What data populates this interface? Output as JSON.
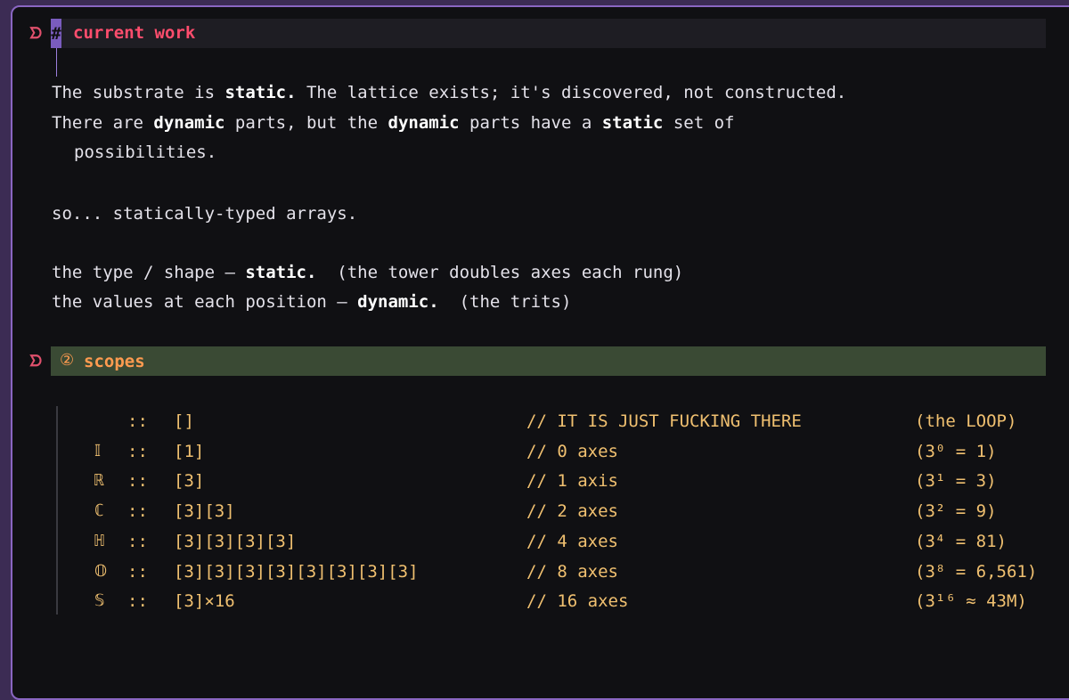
{
  "fold_marker": "ᗤ",
  "heading1": {
    "hash": "#",
    "text": "current work"
  },
  "paragraph": {
    "line1": {
      "a": "The substrate is ",
      "b": "static.",
      "c": " The lattice exists; it's discovered, not constructed."
    },
    "line2": {
      "a": "There are ",
      "b": "dynamic",
      "c": " parts, but the ",
      "d": "dynamic",
      "e": " parts have a ",
      "f": "static",
      "g": " set of"
    },
    "line3": "possibilities."
  },
  "so_line": "so... statically-typed arrays.",
  "type_line": {
    "a": "the type / shape — ",
    "b": "static.",
    "c": "  (the tower doubles axes each rung)"
  },
  "values_line": {
    "a": "the values at each position — ",
    "b": "dynamic.",
    "c": "  (the trits)"
  },
  "heading2": {
    "icon": "②",
    "text": "scopes"
  },
  "scopes": [
    {
      "glyph": "",
      "sep": "::",
      "shape": "[]",
      "comment": "// IT IS JUST FUCKING THERE",
      "note": "(the LOOP)"
    },
    {
      "glyph": "𝕀",
      "sep": "::",
      "shape": "[1]",
      "comment": "// 0 axes",
      "note": "(3⁰ = 1)"
    },
    {
      "glyph": "ℝ",
      "sep": "::",
      "shape": "[3]",
      "comment": "// 1 axis",
      "note": "(3¹ = 3)"
    },
    {
      "glyph": "ℂ",
      "sep": "::",
      "shape": "[3][3]",
      "comment": "// 2 axes",
      "note": "(3² = 9)"
    },
    {
      "glyph": "ℍ",
      "sep": "::",
      "shape": "[3][3][3][3]",
      "comment": "// 4 axes",
      "note": "(3⁴ = 81)"
    },
    {
      "glyph": "𝕆",
      "sep": "::",
      "shape": "[3][3][3][3][3][3][3][3]",
      "comment": "// 8 axes",
      "note": "(3⁸ = 6,561)"
    },
    {
      "glyph": "𝕊",
      "sep": "::",
      "shape": "[3]×16",
      "comment": "// 16 axes",
      "note": "(3¹⁶ ≈ 43M)"
    }
  ],
  "colors": {
    "heading1": "#ff4d6d",
    "heading2": "#ff9b50",
    "code": "#f0c070",
    "border": "#8a66c2"
  }
}
